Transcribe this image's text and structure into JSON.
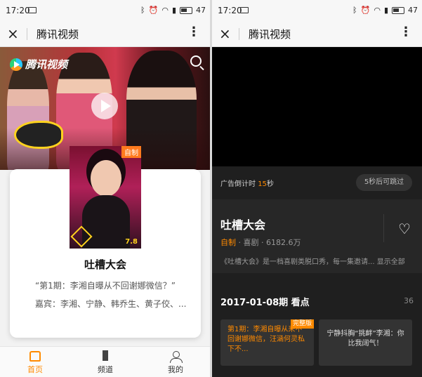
{
  "status_bar": {
    "time": "17:20",
    "battery": "47"
  },
  "titlebar": {
    "close_icon": "×",
    "title": "腾讯视频",
    "more_icon": "⋮"
  },
  "left": {
    "hero": {
      "logo_text": "腾讯视频"
    },
    "card": {
      "badge": "自制",
      "score": "7.8",
      "name": "吐槽大会",
      "desc": "“第1期：李湘自曝从不回谢娜微信？”",
      "guests": "嘉宾：李湘、宁静、韩乔生、黄子佼、..."
    },
    "tabbar": [
      {
        "label": "首页",
        "icon": "home-icon"
      },
      {
        "label": "频道",
        "icon": "grid-icon"
      },
      {
        "label": "我的",
        "icon": "person-icon"
      }
    ]
  },
  "right": {
    "ad": {
      "prefix": "广告倒计时",
      "seconds": "15",
      "suffix": "秒"
    },
    "skip_label": "5秒后可跳过",
    "show_title": "吐槽大会",
    "meta": {
      "tag": "自制",
      "rest": " · 喜剧 · 6182.6万"
    },
    "intro": "《吐槽大会》是一档喜剧类脱口秀，每一集邀请...   显示全部",
    "episode_header": "2017-01-08期 看点",
    "episode_count": "36",
    "episodes": [
      {
        "badge": "完整版",
        "text": "第1期：李湘自曝从来不回谢娜微信，汪涵何灵私下不..."
      },
      {
        "text": "宁静抖胸“挑衅”李湘：你比我阔气！"
      }
    ]
  },
  "colors": {
    "accent": "#ff8a00"
  }
}
